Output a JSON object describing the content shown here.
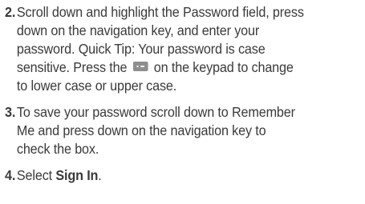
{
  "steps": [
    {
      "number": "2.",
      "line1": "Scroll down and highlight the Password field, press",
      "line2": "down on the navigation key, and enter your",
      "line3": "password. Quick Tip: Your password is case",
      "line4_before_icon": "sensitive. Press the",
      "key_icon": "shift-key-icon",
      "line4_after_icon": "on the keypad to change",
      "line5": "to lower case or upper case."
    },
    {
      "number": "3.",
      "line1": "To save your password scroll down to Remember",
      "line2": "Me and press down on the navigation key to",
      "line3": "check the box."
    },
    {
      "number": "4.",
      "text_before": "Select ",
      "bold_text": "Sign In",
      "text_after": "."
    }
  ]
}
